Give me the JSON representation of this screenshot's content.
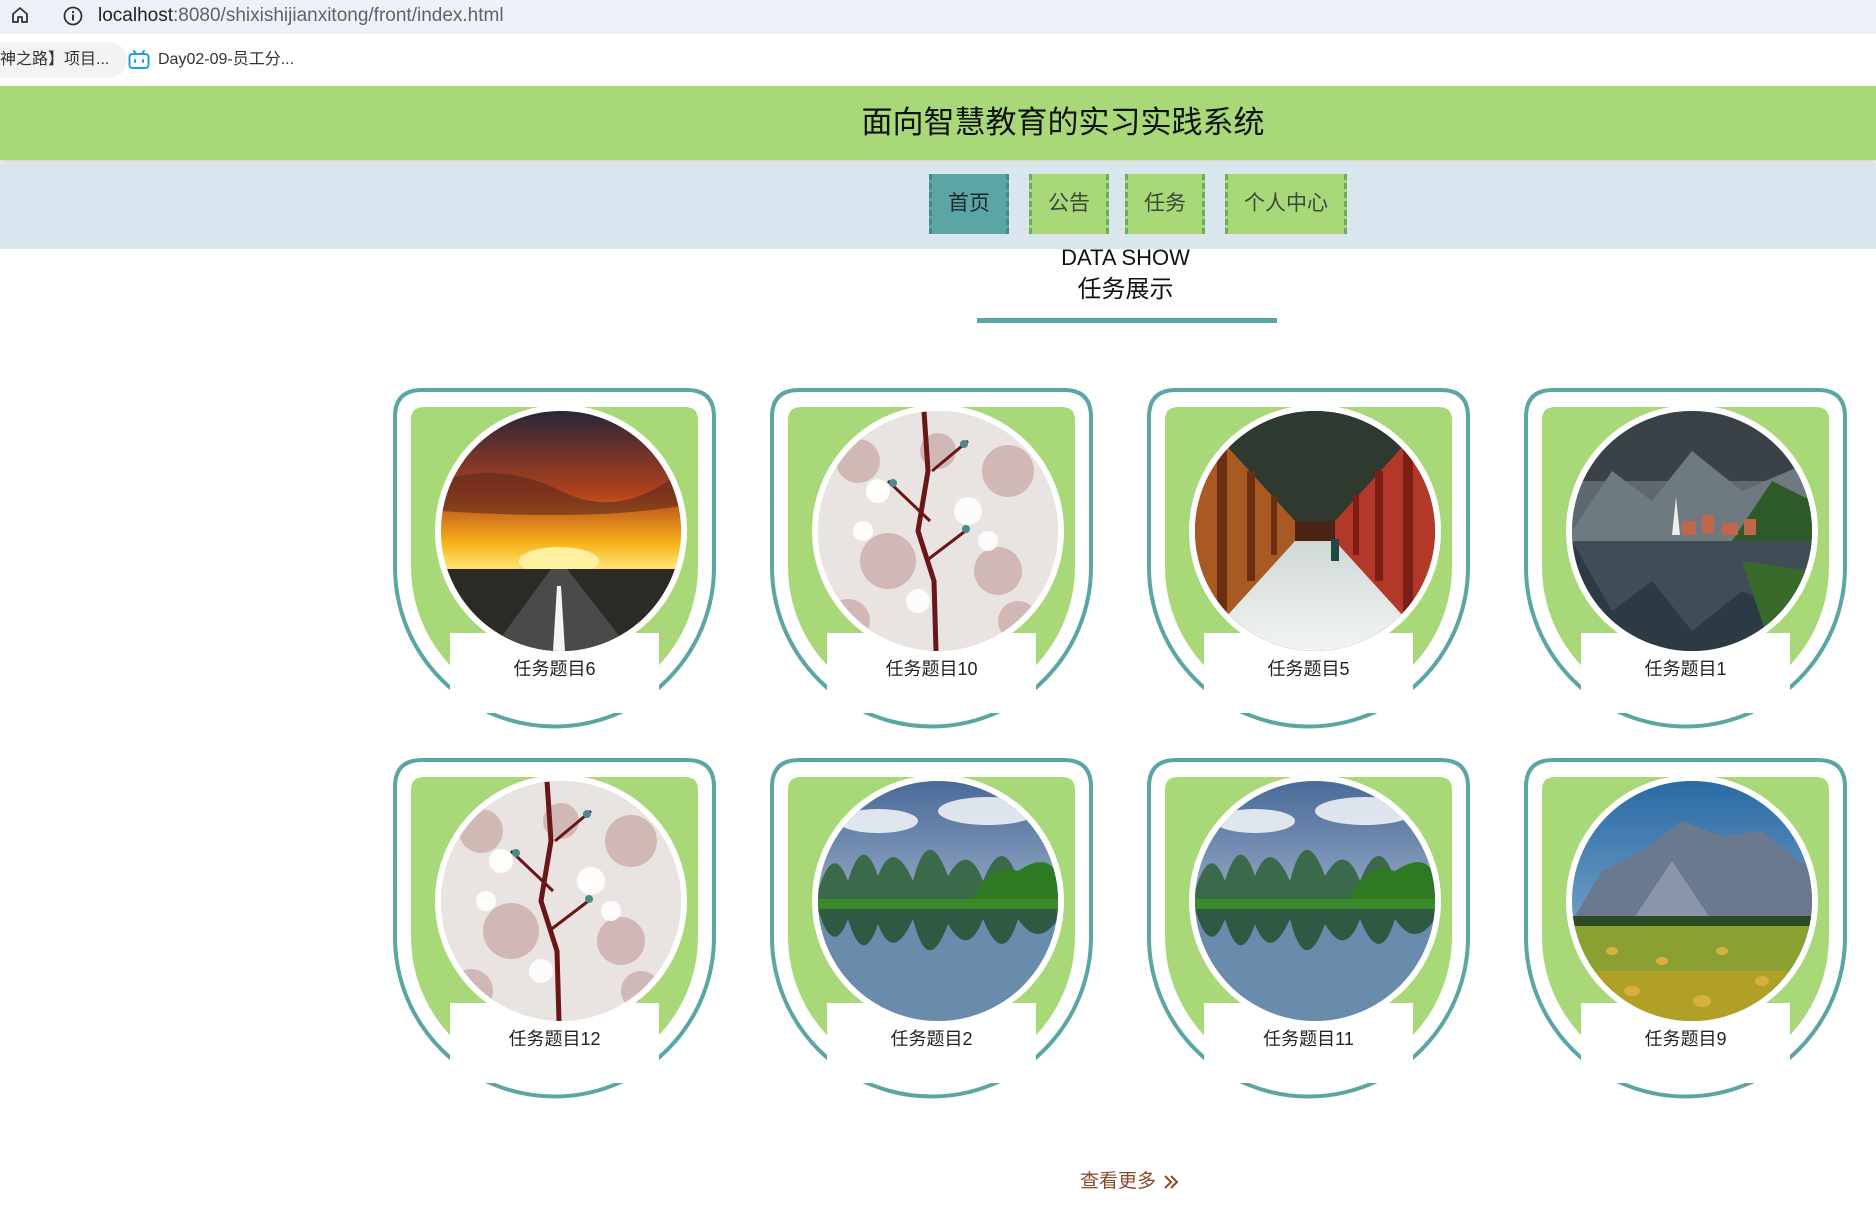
{
  "browser": {
    "url_host": "localhost",
    "url_rest": ":8080/shixishijianxitong/front/index.html",
    "bookmarks": [
      {
        "label": "神之路】项目..."
      },
      {
        "label": "Day02-09-员工分..."
      }
    ]
  },
  "header": {
    "title": "面向智慧教育的实习实践系统"
  },
  "nav": {
    "items": [
      {
        "label": "首页",
        "active": true
      },
      {
        "label": "公告",
        "active": false
      },
      {
        "label": "任务",
        "active": false
      },
      {
        "label": "个人中心",
        "active": false
      }
    ]
  },
  "section": {
    "subtitle": "DATA SHOW",
    "title": "任务展示"
  },
  "tasks": [
    {
      "title": "任务题目6",
      "image": "sunset-road"
    },
    {
      "title": "任务题目10",
      "image": "cherry-blossom"
    },
    {
      "title": "任务题目5",
      "image": "corridor"
    },
    {
      "title": "任务题目1",
      "image": "lake-village"
    },
    {
      "title": "任务题目12",
      "image": "cherry-blossom"
    },
    {
      "title": "任务题目2",
      "image": "karst-river"
    },
    {
      "title": "任务题目11",
      "image": "karst-river"
    },
    {
      "title": "任务题目9",
      "image": "mountain-field"
    }
  ],
  "more": {
    "label": "查看更多"
  },
  "colors": {
    "header_green": "#a8d878",
    "accent_teal": "#5ba5a5",
    "nav_bg": "#dae6ee"
  }
}
